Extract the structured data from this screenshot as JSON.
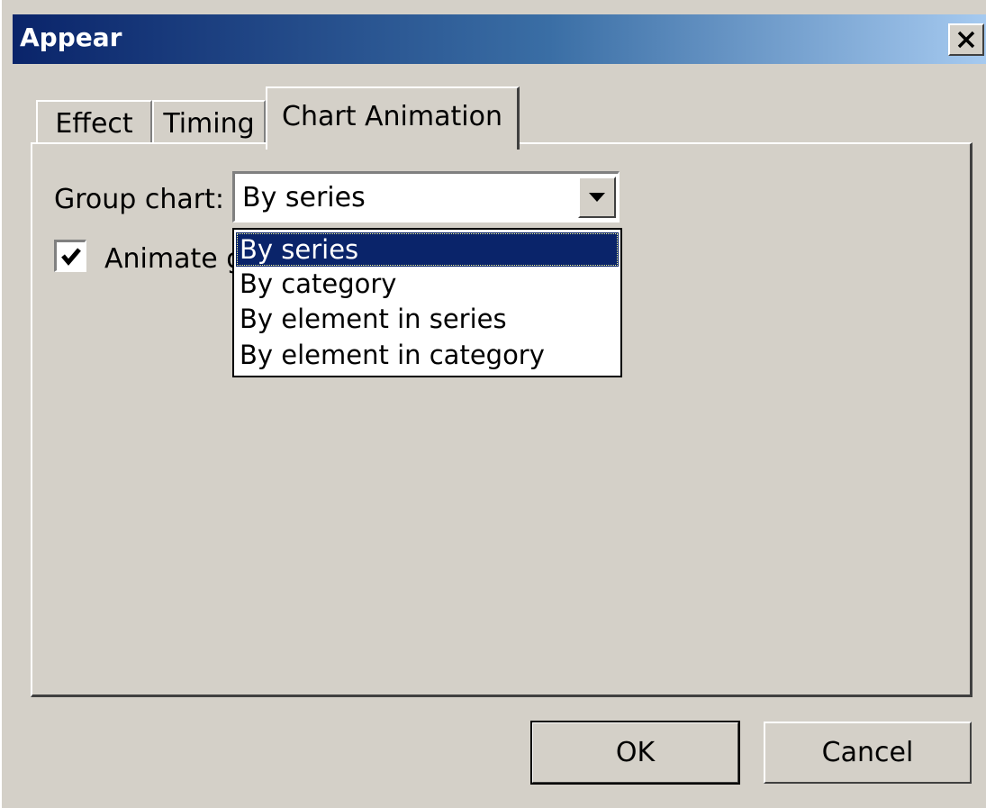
{
  "window": {
    "title": "Appear",
    "close_label": "×"
  },
  "tabs": [
    {
      "label": "Effect",
      "active": false
    },
    {
      "label": "Timing",
      "active": false
    },
    {
      "label": "Chart Animation",
      "active": true
    }
  ],
  "group_chart": {
    "label": "Group chart:",
    "selected": "By series",
    "options": [
      "By series",
      "By category",
      "By element in series",
      "By element in category"
    ],
    "open": true
  },
  "animate_grid": {
    "label": "Animate grid and legend",
    "visible_label": "Animate g",
    "checked": true
  },
  "buttons": {
    "ok": "OK",
    "cancel": "Cancel"
  },
  "colors": {
    "title_gradient_start": "#0a246a",
    "title_gradient_end": "#a6caf0",
    "face": "#d4d0c8",
    "selection": "#0a246a"
  }
}
